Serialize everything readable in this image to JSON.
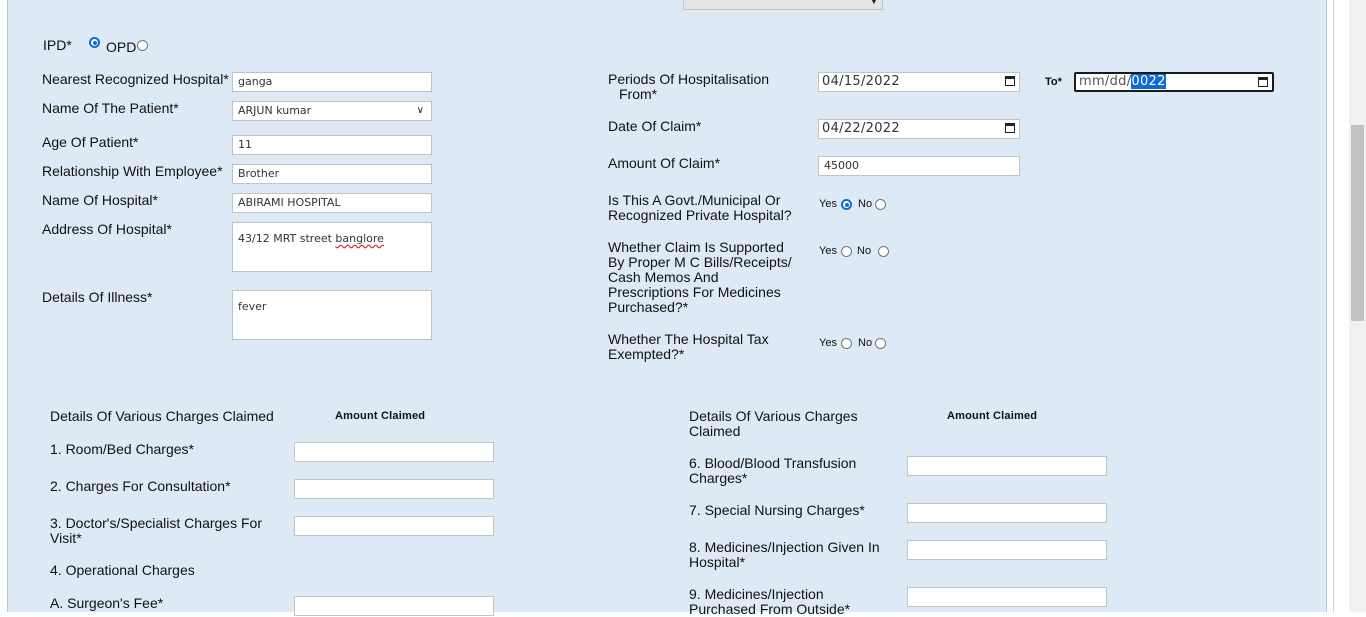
{
  "top_select": {
    "value": ""
  },
  "visit_type": {
    "ipd_label": "IPD*",
    "opd_label": "OPD",
    "selected": "IPD"
  },
  "left_form": {
    "nearest_hospital": {
      "label": "Nearest Recognized Hospital*",
      "value": "ganga"
    },
    "patient_name": {
      "label": "Name Of The Patient*",
      "value": "ARJUN kumar"
    },
    "patient_age": {
      "label": "Age Of Patient*",
      "value": "11"
    },
    "relationship": {
      "label": "Relationship With Employee*",
      "value": "Brother"
    },
    "hospital_name": {
      "label": "Name Of Hospital*",
      "value": "ABIRAMI HOSPITAL"
    },
    "hospital_address": {
      "label": "Address Of Hospital*",
      "value_prefix": "43/12 MRT street ",
      "value_misspelled": "banglore"
    },
    "illness_details": {
      "label": "Details Of Illness*",
      "value": "fever"
    }
  },
  "right_form": {
    "period": {
      "label_line1": "Periods Of Hospitalisation",
      "label_line2": "From*",
      "from_value": "04/15/2022",
      "to_label": "To*",
      "to_value_prefix": "mm/dd/",
      "to_value_selected": "0022"
    },
    "claim_date": {
      "label": "Date Of Claim*",
      "value": "04/22/2022"
    },
    "claim_amount": {
      "label": "Amount Of Claim*",
      "value": "45000"
    },
    "govt_hospital": {
      "label_line1": "Is This A Govt./Municipal Or",
      "label_line2": "Recognized Private Hospital?",
      "yes": "Yes",
      "no": "No",
      "selected": "Yes"
    },
    "bills_supported": {
      "label_lines": [
        "Whether Claim Is Supported",
        "By Proper M C Bills/Receipts/",
        "Cash Memos And",
        "Prescriptions For Medicines",
        "Purchased?*"
      ],
      "yes": "Yes",
      "no": "No",
      "selected": ""
    },
    "tax_exempted": {
      "label_line1": "Whether The Hospital Tax",
      "label_line2": "Exempted?*",
      "yes": "Yes",
      "no": "No",
      "selected": ""
    }
  },
  "charges_left": {
    "header": "Details Of Various Charges Claimed",
    "amount_header": "Amount Claimed",
    "room": "1. Room/Bed Charges*",
    "consultation": "2. Charges For Consultation*",
    "doctor_line1": "3. Doctor's/Specialist Charges For",
    "doctor_line2": "Visit*",
    "operational": "4. Operational Charges",
    "surgeon": "A. Surgeon's Fee*"
  },
  "charges_right": {
    "header_line1": "Details Of Various Charges",
    "header_line2": "Claimed",
    "amount_header": "Amount Claimed",
    "blood_line1": "6. Blood/Blood Transfusion",
    "blood_line2": "Charges*",
    "nursing": "7. Special Nursing Charges*",
    "medicines_in_line1": "8. Medicines/Injection Given In",
    "medicines_in_line2": "Hospital*",
    "medicines_out_line1": "9. Medicines/Injection",
    "medicines_out_line2": "Purchased From Outside*"
  }
}
